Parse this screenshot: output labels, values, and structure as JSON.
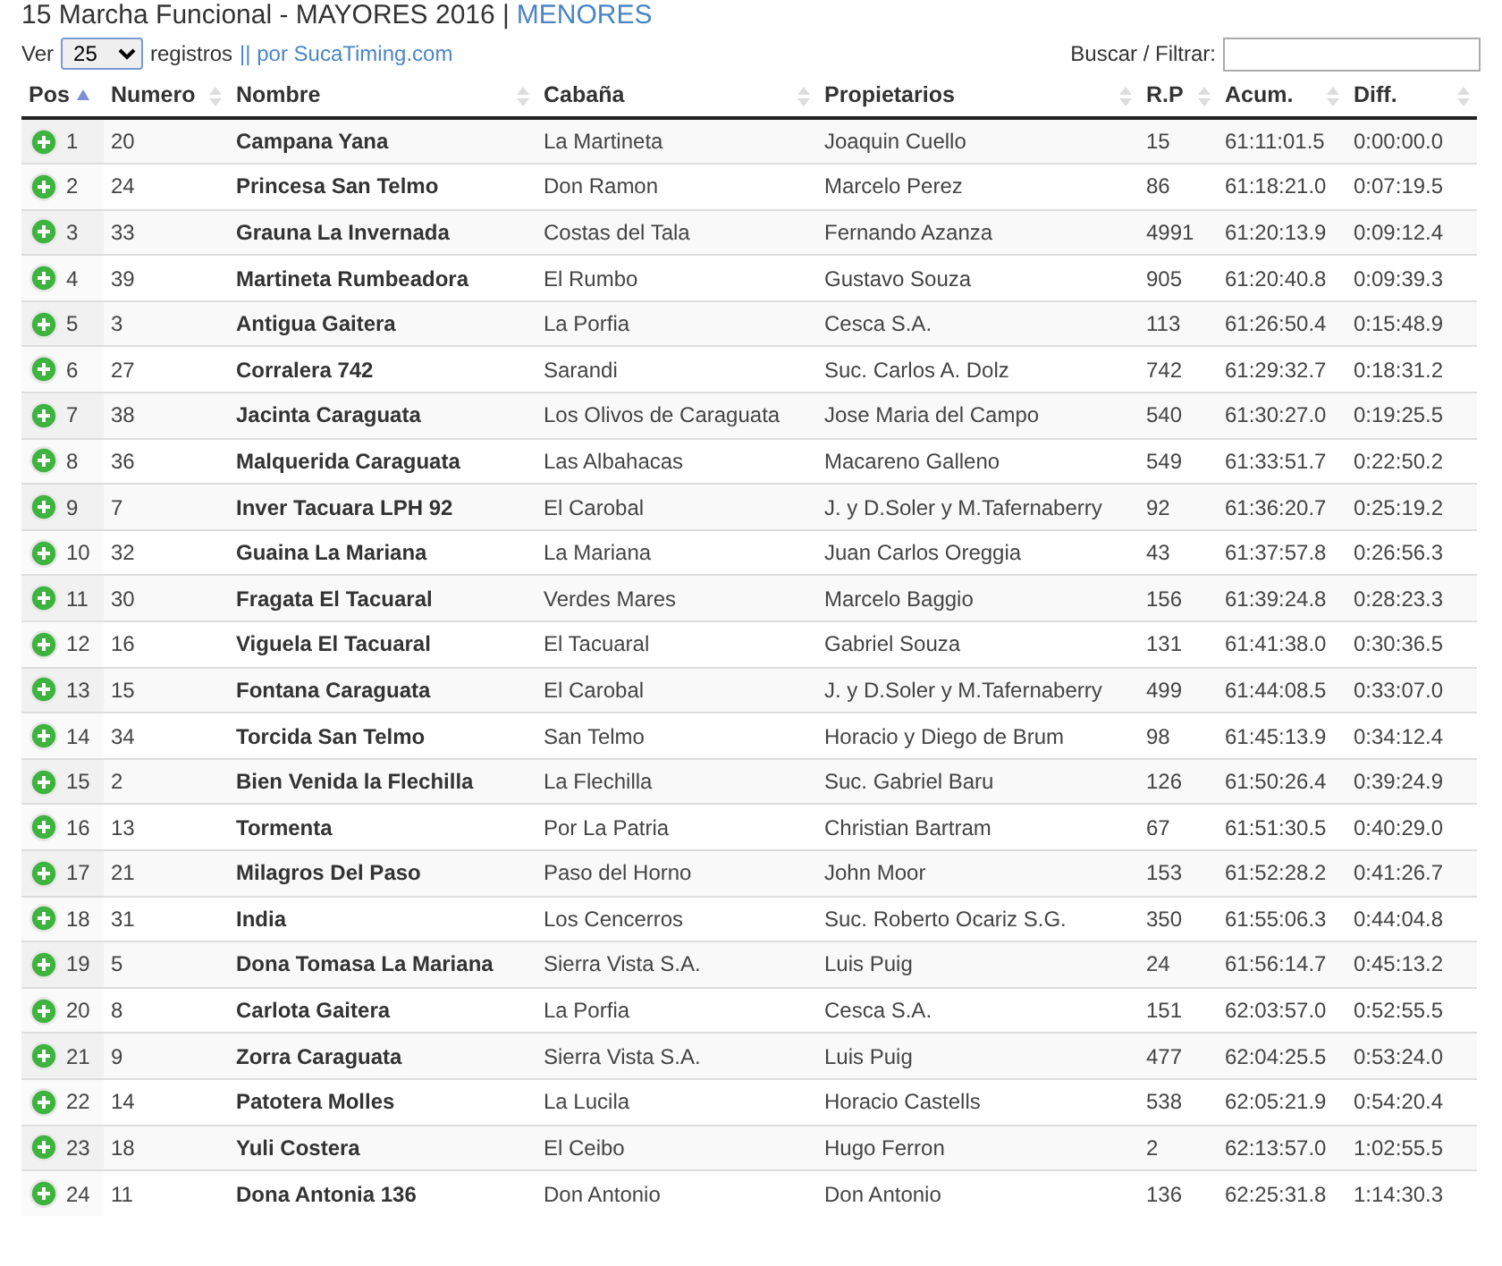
{
  "title": {
    "text": "15 Marcha Funcional - MAYORES 2016 |",
    "link": "MENORES"
  },
  "controls": {
    "show_label": "Ver",
    "page_size": "25",
    "records_label": "registros",
    "separator": "||",
    "credit_link": "por SucaTiming.com",
    "search_label": "Buscar / Filtrar:"
  },
  "table": {
    "columns": [
      {
        "label": "Pos",
        "sorted": true
      },
      {
        "label": "Numero",
        "sorted": false
      },
      {
        "label": "Nombre",
        "sorted": false
      },
      {
        "label": "Cabaña",
        "sorted": false
      },
      {
        "label": "Propietarios",
        "sorted": false
      },
      {
        "label": "R.P",
        "sorted": false
      },
      {
        "label": "Acum.",
        "sorted": false
      },
      {
        "label": "Diff.",
        "sorted": false
      }
    ],
    "rows": [
      [
        "1",
        "20",
        "Campana Yana",
        "La Martineta",
        "Joaquin Cuello",
        "15",
        "61:11:01.5",
        "0:00:00.0"
      ],
      [
        "2",
        "24",
        "Princesa San Telmo",
        "Don Ramon",
        "Marcelo Perez",
        "86",
        "61:18:21.0",
        "0:07:19.5"
      ],
      [
        "3",
        "33",
        "Grauna La Invernada",
        "Costas del Tala",
        "Fernando Azanza",
        "4991",
        "61:20:13.9",
        "0:09:12.4"
      ],
      [
        "4",
        "39",
        "Martineta Rumbeadora",
        "El Rumbo",
        "Gustavo Souza",
        "905",
        "61:20:40.8",
        "0:09:39.3"
      ],
      [
        "5",
        "3",
        "Antigua Gaitera",
        "La Porfia",
        "Cesca S.A.",
        "113",
        "61:26:50.4",
        "0:15:48.9"
      ],
      [
        "6",
        "27",
        "Corralera 742",
        "Sarandi",
        "Suc. Carlos A. Dolz",
        "742",
        "61:29:32.7",
        "0:18:31.2"
      ],
      [
        "7",
        "38",
        "Jacinta Caraguata",
        "Los Olivos de Caraguata",
        "Jose Maria del Campo",
        "540",
        "61:30:27.0",
        "0:19:25.5"
      ],
      [
        "8",
        "36",
        "Malquerida Caraguata",
        "Las Albahacas",
        "Macareno Galleno",
        "549",
        "61:33:51.7",
        "0:22:50.2"
      ],
      [
        "9",
        "7",
        "Inver Tacuara LPH 92",
        "El Carobal",
        "J. y D.Soler y M.Tafernaberry",
        "92",
        "61:36:20.7",
        "0:25:19.2"
      ],
      [
        "10",
        "32",
        "Guaina La Mariana",
        "La Mariana",
        "Juan Carlos Oreggia",
        "43",
        "61:37:57.8",
        "0:26:56.3"
      ],
      [
        "11",
        "30",
        "Fragata El Tacuaral",
        "Verdes Mares",
        "Marcelo Baggio",
        "156",
        "61:39:24.8",
        "0:28:23.3"
      ],
      [
        "12",
        "16",
        "Viguela El Tacuaral",
        "El Tacuaral",
        "Gabriel Souza",
        "131",
        "61:41:38.0",
        "0:30:36.5"
      ],
      [
        "13",
        "15",
        "Fontana Caraguata",
        "El Carobal",
        "J. y D.Soler y M.Tafernaberry",
        "499",
        "61:44:08.5",
        "0:33:07.0"
      ],
      [
        "14",
        "34",
        "Torcida San Telmo",
        "San Telmo",
        "Horacio y Diego de Brum",
        "98",
        "61:45:13.9",
        "0:34:12.4"
      ],
      [
        "15",
        "2",
        "Bien Venida la Flechilla",
        "La Flechilla",
        "Suc. Gabriel Baru",
        "126",
        "61:50:26.4",
        "0:39:24.9"
      ],
      [
        "16",
        "13",
        "Tormenta",
        "Por La Patria",
        "Christian Bartram",
        "67",
        "61:51:30.5",
        "0:40:29.0"
      ],
      [
        "17",
        "21",
        "Milagros Del Paso",
        "Paso del Horno",
        "John Moor",
        "153",
        "61:52:28.2",
        "0:41:26.7"
      ],
      [
        "18",
        "31",
        "India",
        "Los Cencerros",
        "Suc. Roberto Ocariz S.G.",
        "350",
        "61:55:06.3",
        "0:44:04.8"
      ],
      [
        "19",
        "5",
        "Dona Tomasa La Mariana",
        "Sierra Vista S.A.",
        "Luis Puig",
        "24",
        "61:56:14.7",
        "0:45:13.2"
      ],
      [
        "20",
        "8",
        "Carlota Gaitera",
        "La Porfia",
        "Cesca S.A.",
        "151",
        "62:03:57.0",
        "0:52:55.5"
      ],
      [
        "21",
        "9",
        "Zorra Caraguata",
        "Sierra Vista S.A.",
        "Luis Puig",
        "477",
        "62:04:25.5",
        "0:53:24.0"
      ],
      [
        "22",
        "14",
        "Patotera Molles",
        "La Lucila",
        "Horacio Castells",
        "538",
        "62:05:21.9",
        "0:54:20.4"
      ],
      [
        "23",
        "18",
        "Yuli Costera",
        "El Ceibo",
        "Hugo Ferron",
        "2",
        "62:13:57.0",
        "1:02:55.5"
      ],
      [
        "24",
        "11",
        "Dona Antonia 136",
        "Don Antonio",
        "Don Antonio",
        "136",
        "62:25:31.8",
        "1:14:30.3"
      ]
    ]
  }
}
